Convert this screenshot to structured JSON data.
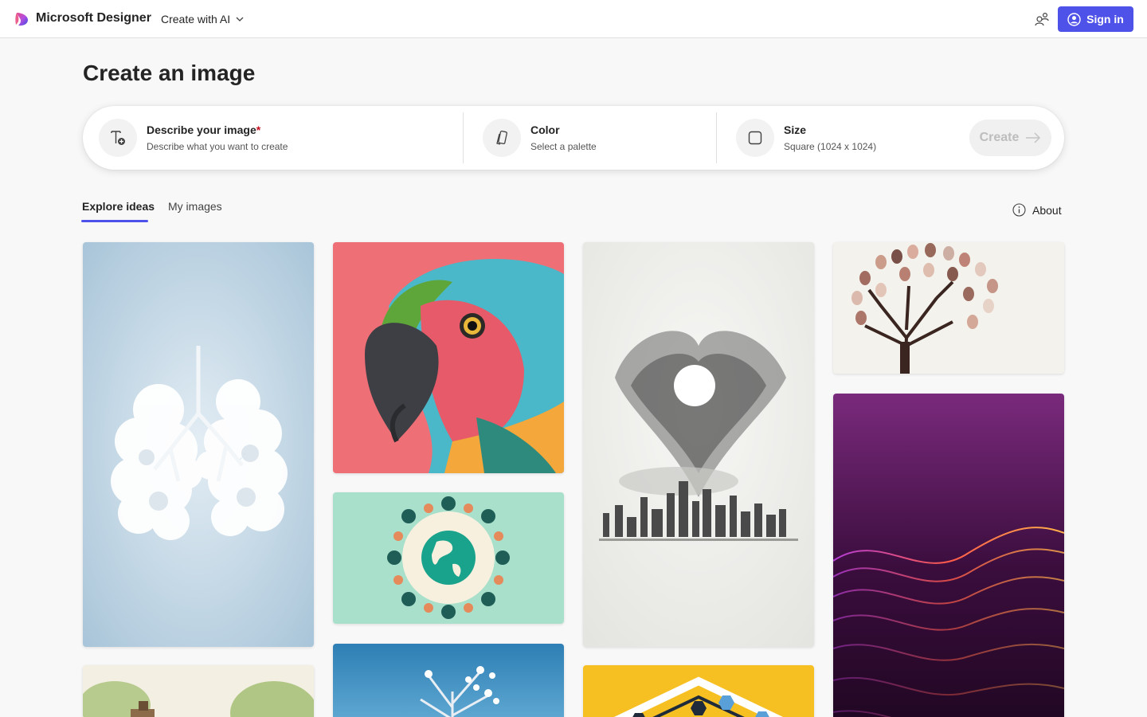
{
  "app": {
    "brand": "Microsoft Designer",
    "nav_menu_label": "Create with AI",
    "sign_in_label": "Sign in"
  },
  "page": {
    "title": "Create an image"
  },
  "prompt": {
    "describe_label": "Describe your image",
    "describe_required_mark": "*",
    "describe_hint": "Describe what you want to create",
    "color_label": "Color",
    "color_hint": "Select a palette",
    "size_label": "Size",
    "size_value": "Square (1024 x 1024)",
    "create_label": "Create"
  },
  "tabs": {
    "explore": "Explore ideas",
    "my_images": "My images",
    "about": "About"
  },
  "gallery": {
    "items": [
      {
        "subject": "cloud lungs watercolor"
      },
      {
        "subject": "colorful macaw parrot"
      },
      {
        "subject": "people around globe"
      },
      {
        "subject": "birds over city"
      },
      {
        "subject": "fingerprint tree"
      },
      {
        "subject": "purple wave particles"
      },
      {
        "subject": "watercolor cottage"
      },
      {
        "subject": "blossom tree on blue"
      },
      {
        "subject": "yellow hexagon pattern"
      }
    ]
  },
  "colors": {
    "accent": "#4f52e8",
    "required": "#c50f1f"
  }
}
